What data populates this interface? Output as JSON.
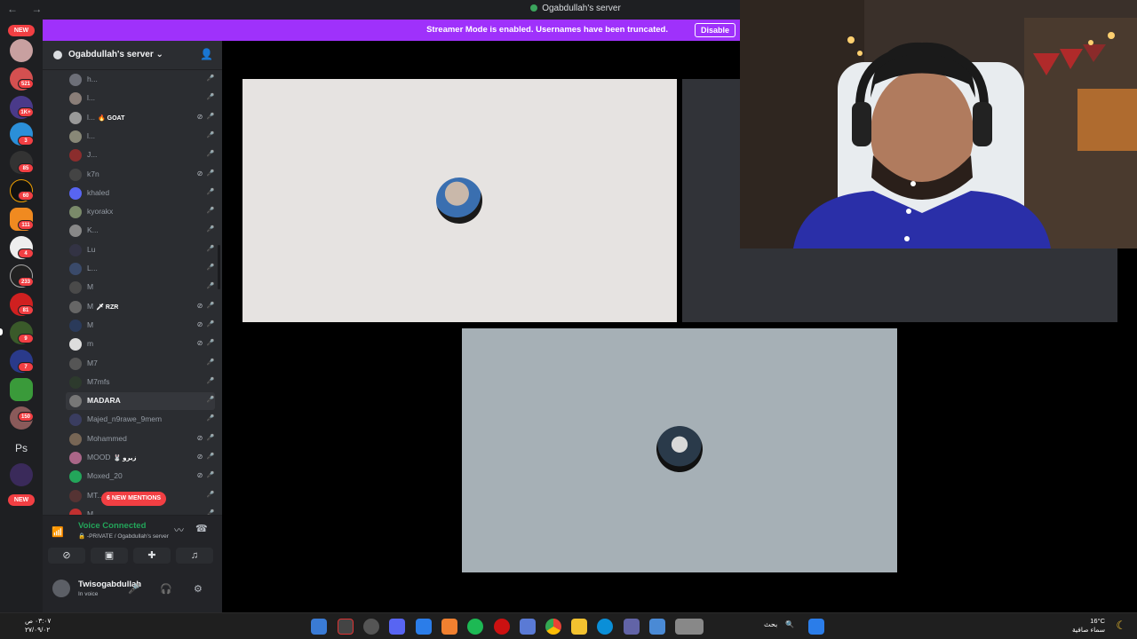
{
  "window": {
    "title": "Ogabdullah's server",
    "nav": "← →"
  },
  "banner": {
    "message": "Streamer Mode is enabled. Usernames have been truncated.",
    "button": "Disable"
  },
  "rail": {
    "top_pill": "NEW",
    "bottom_pill": "NEW",
    "badges": [
      "521",
      "1K+",
      "3",
      "85",
      "60",
      "111",
      "4",
      "233",
      "81",
      "9",
      "7",
      "150"
    ],
    "ps_label": "Ps"
  },
  "server": {
    "name": "Ogabdullah's server",
    "chevron": "⌄"
  },
  "members": [
    {
      "name": "h...",
      "tag": "",
      "color": "#6d6f78"
    },
    {
      "name": "l...",
      "tag": "",
      "color": "#8a7e78"
    },
    {
      "name": "l...",
      "tag": "🔥 GOAT",
      "color": "#999"
    },
    {
      "name": "l...",
      "tag": "",
      "color": "#887"
    },
    {
      "name": "J...",
      "tag": "",
      "color": "#8b2d2d"
    },
    {
      "name": "k7n",
      "tag": "",
      "color": "#444"
    },
    {
      "name": "khaled",
      "tag": "",
      "color": "#5865f2"
    },
    {
      "name": "kyorakx",
      "tag": "",
      "color": "#7a8a6a"
    },
    {
      "name": "K...",
      "tag": "",
      "color": "#888"
    },
    {
      "name": "Lu",
      "tag": "",
      "color": "#334"
    },
    {
      "name": "L...",
      "tag": "",
      "color": "#3a4a6a"
    },
    {
      "name": "M",
      "tag": "",
      "color": "#4a4a4a"
    },
    {
      "name": "M",
      "tag": "🗡 RZR",
      "color": "#666"
    },
    {
      "name": "M",
      "tag": "",
      "color": "#2a3a5a"
    },
    {
      "name": "m",
      "tag": "",
      "color": "#ddd"
    },
    {
      "name": "M7",
      "tag": "",
      "color": "#555"
    },
    {
      "name": "M7mfs",
      "tag": "",
      "color": "#2d3a2d"
    },
    {
      "name": "MADARA",
      "tag": "",
      "color": "#777"
    },
    {
      "name": "Majed_n9rawe_9mem",
      "tag": "",
      "color": "#3a3d60"
    },
    {
      "name": "Mohammed",
      "tag": "",
      "color": "#776655"
    },
    {
      "name": "MOOD",
      "tag": "🐰 زيرو",
      "color": "#aa6688"
    },
    {
      "name": "Moxed_20",
      "tag": "",
      "color": "#23a55a"
    },
    {
      "name": "MT...",
      "tag": "",
      "color": "#553333"
    },
    {
      "name": "M...",
      "tag": "",
      "color": "#c03030"
    }
  ],
  "mentions": "6 NEW MENTIONS",
  "voice": {
    "status": "Voice Connected",
    "location": "🔒 -PRIVATE / Ogabdullah's server"
  },
  "user": {
    "name": "Twisogabdullah",
    "status": "In voice"
  },
  "taskbar": {
    "clock_time": "٠٣:٠٧ ص",
    "clock_date": "٢٧/٠٩/٠٢",
    "search": "بحث",
    "temp": "16°C",
    "weather": "سماء صافية"
  },
  "colors": {
    "accent": "#9f31fb",
    "danger": "#f23f43",
    "online": "#23a55a"
  }
}
